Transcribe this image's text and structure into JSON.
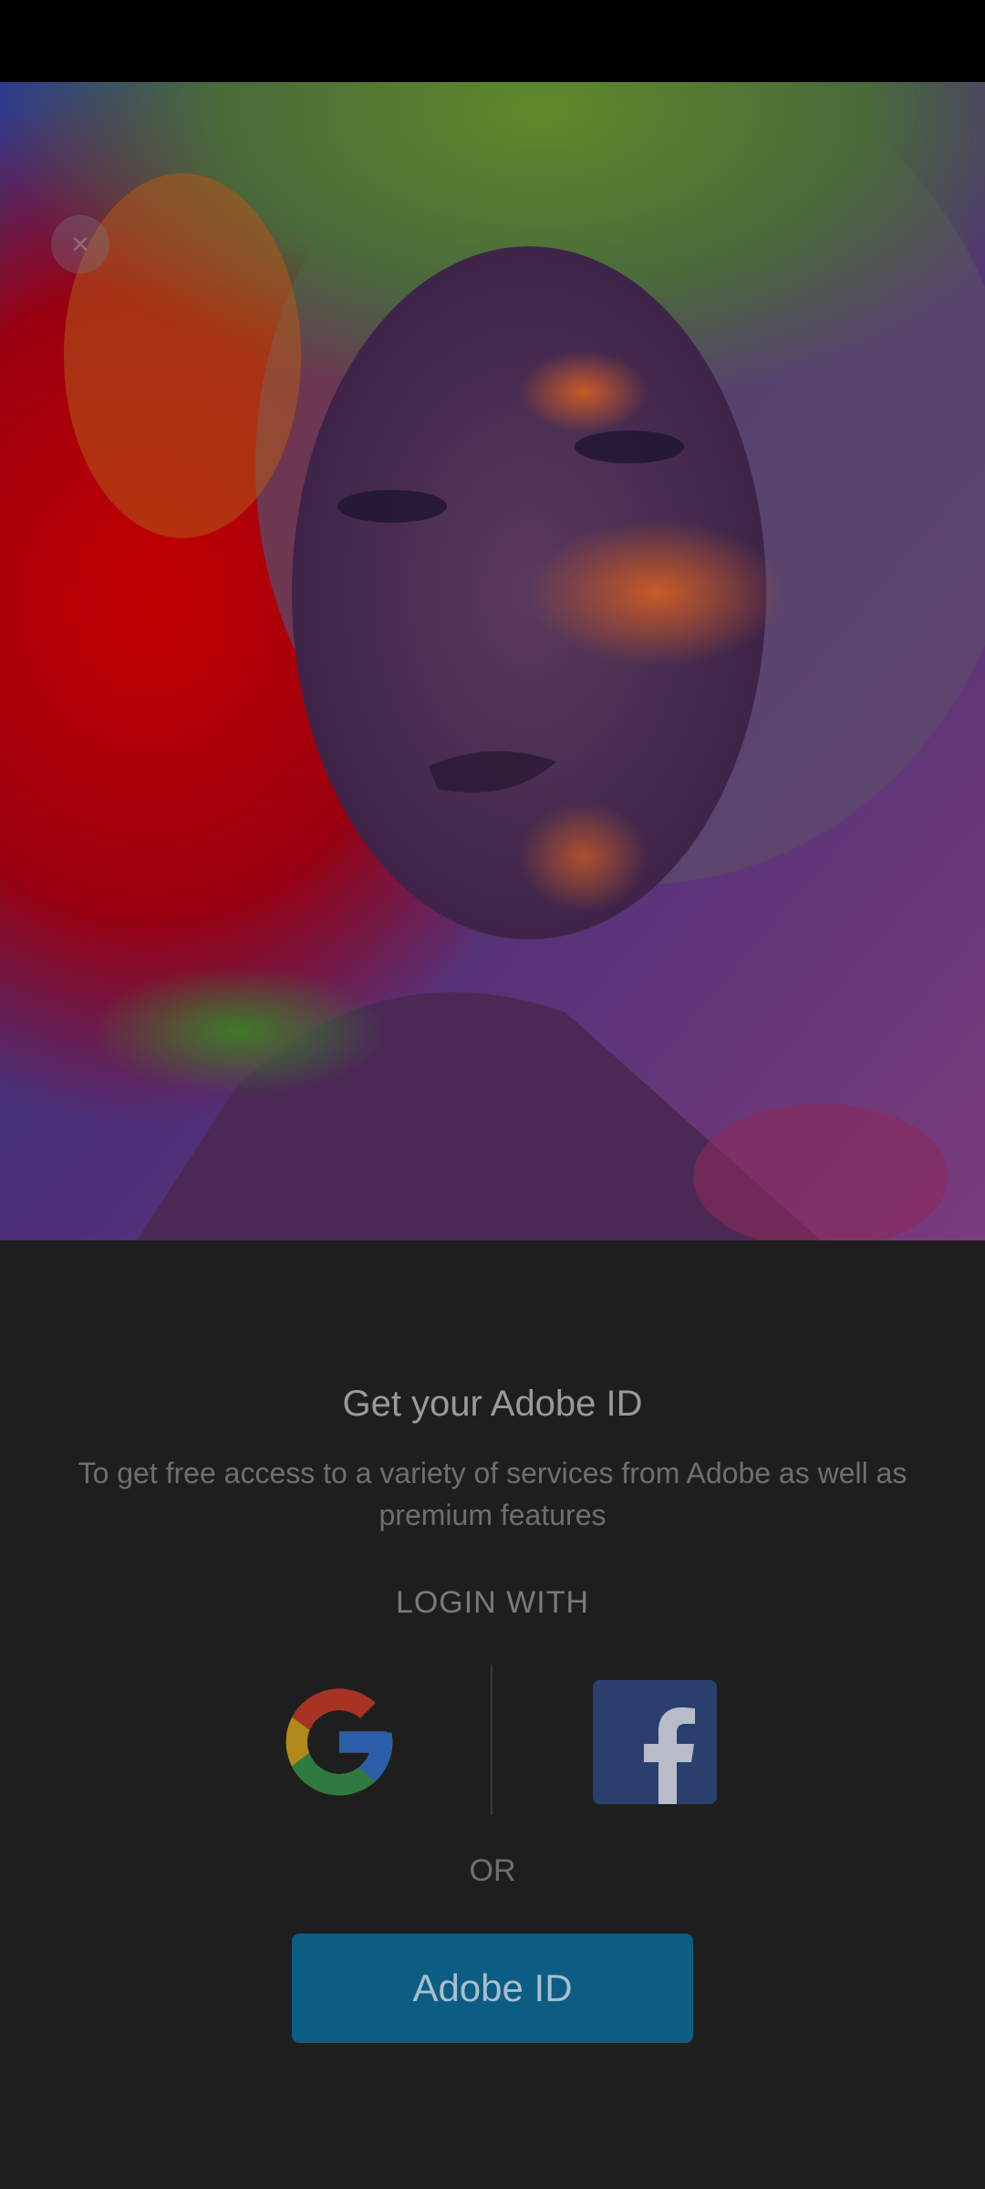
{
  "hero": {
    "close_glyph": "×"
  },
  "login": {
    "title": "Get your Adobe ID",
    "subtitle": "To get free access to a variety of services from Adobe as well as premium features",
    "login_with_label": "LOGIN WITH",
    "google_icon": "google-icon",
    "facebook_icon": "facebook-icon",
    "or_label": "OR",
    "adobe_id_button": "Adobe ID"
  },
  "colors": {
    "panel_background": "#1e1e1e",
    "adobe_button": "#0b5d84",
    "facebook_button": "#2a3f6e"
  }
}
